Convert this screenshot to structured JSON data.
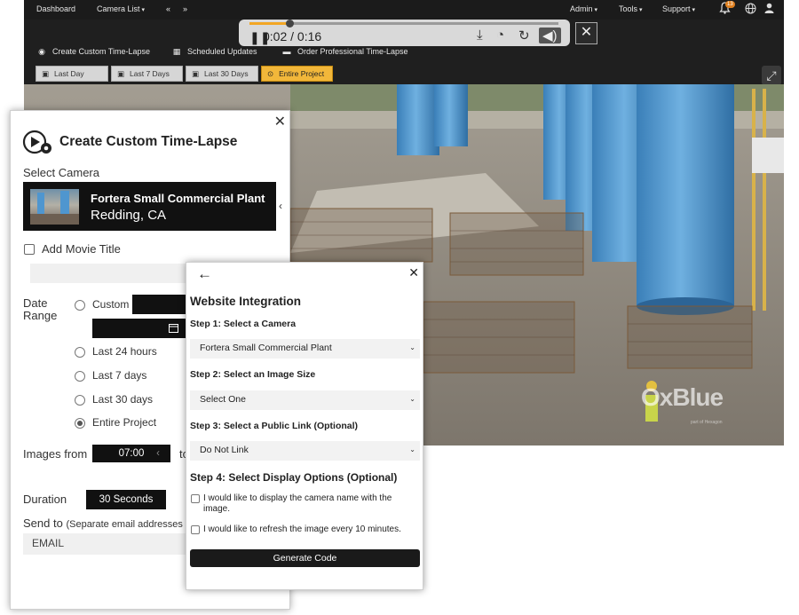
{
  "topnav": {
    "left_items": [
      "Dashboard",
      "Camera List",
      "«",
      "»"
    ],
    "right_items": [
      "Admin",
      "Tools",
      "Support"
    ],
    "notification_count": "13"
  },
  "player": {
    "time": "0:02 / 0:16",
    "progress": 0.13
  },
  "actions": {
    "create": "Create Custom Time-Lapse",
    "scheduled": "Scheduled Updates",
    "order": "Order Professional Time-Lapse"
  },
  "ranges": [
    "Last Day",
    "Last 7 Days",
    "Last 30 Days",
    "Entire Project"
  ],
  "active_range": "Entire Project",
  "watermark": {
    "brand": "OxBlue",
    "sub": "part of Hexagon"
  },
  "colors": {
    "accent": "#f2b73a",
    "dark": "#111111",
    "tank": "#4f96cf"
  },
  "ctl": {
    "title": "Create Custom Time-Lapse",
    "select_camera": "Select Camera",
    "camera_name": "Fortera Small Commercial Plant",
    "camera_location": "Redding, CA",
    "add_movie_title": "Add Movie Title",
    "date_range_line1": "Date",
    "date_range_line2": "Range",
    "options": [
      "Custom",
      "Last 24 hours",
      "Last 7 days",
      "Last 30 days",
      "Entire Project"
    ],
    "selected_option": "Entire Project",
    "images_from": "Images from",
    "from_time": "07:00",
    "to": "to",
    "duration": "Duration",
    "duration_value": "30 Seconds",
    "send_to": "Send to",
    "send_to_hint": "(Separate email addresses",
    "email_placeholder": "EMAIL"
  },
  "wi": {
    "title": "Website Integration",
    "step1": "Step 1: Select a Camera",
    "step1_value": "Fortera Small Commercial Plant",
    "step2": "Step 2: Select an Image Size",
    "step2_value": "Select One",
    "step3": "Step 3: Select a Public Link (Optional)",
    "step3_value": "Do Not Link",
    "step4": "Step 4: Select Display Options (Optional)",
    "opt1": "I would like to display the camera name with the image.",
    "opt2": "I would like to refresh the image every 10 minutes.",
    "generate": "Generate Code"
  }
}
